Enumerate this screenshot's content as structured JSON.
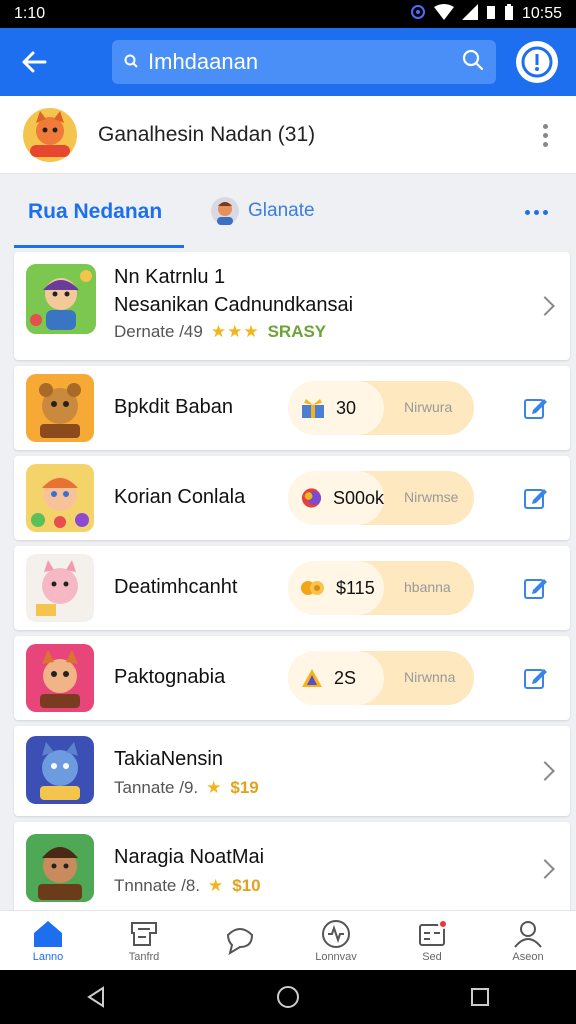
{
  "status_bar": {
    "left_time": "1:10",
    "right_time": "10:55"
  },
  "app_bar": {
    "search_placeholder": "Imhdaanan"
  },
  "header": {
    "title": "Ganalhesin Nadan (31)"
  },
  "tabs": {
    "active_label": "Rua Nedanan",
    "second_label": "Glanate"
  },
  "list": [
    {
      "type": "info",
      "title_line1": "Nn Katrnlu 1",
      "title_line2": "Nesanikan Cadnundkansai",
      "meta": "Dernate /49",
      "stars": "★★★",
      "tag": "SRASY"
    },
    {
      "type": "pill",
      "title": "Bpkdit Baban",
      "pill_value": "30",
      "pill_label": "Nirwura"
    },
    {
      "type": "pill",
      "title": "Korian Conlala",
      "pill_value": "S00ok",
      "pill_label": "Nirwmse"
    },
    {
      "type": "pill",
      "title": "Deatimhcanht",
      "pill_value": "$115",
      "pill_label": "hbanna"
    },
    {
      "type": "pill",
      "title": "Paktognabia",
      "pill_value": "2S",
      "pill_label": "Nirwnna"
    },
    {
      "type": "info2",
      "title": "TakiaNensin",
      "meta": "Tannate /9.",
      "stars": "★",
      "price": "$19"
    },
    {
      "type": "info2",
      "title": "Naragia NoatMai",
      "meta": "Tnnnate /8.",
      "stars": "★",
      "price": "$10"
    }
  ],
  "bottom_nav": [
    {
      "label": "Lanno",
      "icon": "home-icon"
    },
    {
      "label": "Tanfrd",
      "icon": "ticket-icon"
    },
    {
      "label": "",
      "icon": "chat-icon"
    },
    {
      "label": "Lonnvav",
      "icon": "heart-icon"
    },
    {
      "label": "Sed",
      "icon": "calendar-icon"
    },
    {
      "label": "Aseon",
      "icon": "profile-icon"
    }
  ],
  "colors": {
    "primary": "#1e6ff0",
    "pill": "#fde8c0",
    "star": "#f3b51b"
  }
}
